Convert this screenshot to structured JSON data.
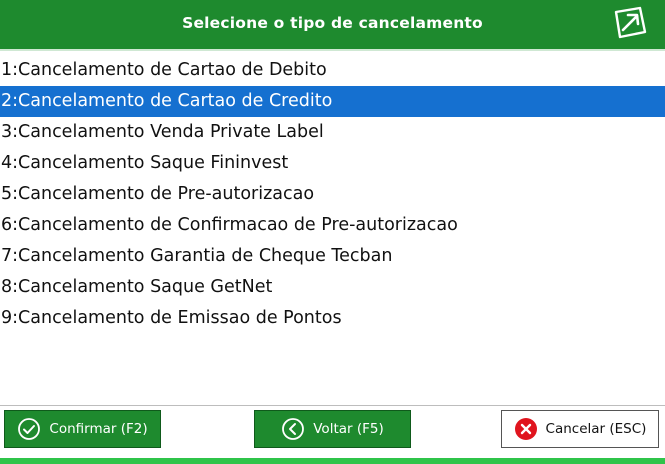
{
  "header": {
    "title": "Selecione o tipo de cancelamento",
    "exit_icon": "exit-arrow-icon"
  },
  "options": [
    {
      "label": "1:Cancelamento de Cartao de Debito"
    },
    {
      "label": "2:Cancelamento de Cartao de Credito"
    },
    {
      "label": "3:Cancelamento Venda Private Label"
    },
    {
      "label": "4:Cancelamento Saque Fininvest"
    },
    {
      "label": "5:Cancelamento de Pre-autorizacao"
    },
    {
      "label": "6:Cancelamento de Confirmacao de Pre-autorizacao"
    },
    {
      "label": "7:Cancelamento Garantia de Cheque Tecban"
    },
    {
      "label": "8:Cancelamento Saque GetNet"
    },
    {
      "label": "9:Cancelamento de Emissao de Pontos"
    }
  ],
  "selected_index": 1,
  "footer": {
    "confirm_label": "Confirmar (F2)",
    "back_label": "Voltar (F5)",
    "cancel_label": "Cancelar (ESC)"
  },
  "colors": {
    "header_green": "#1e8a2e",
    "selection_blue": "#1570d0",
    "cancel_red": "#e0141e",
    "strip_green": "#2fc44a"
  }
}
